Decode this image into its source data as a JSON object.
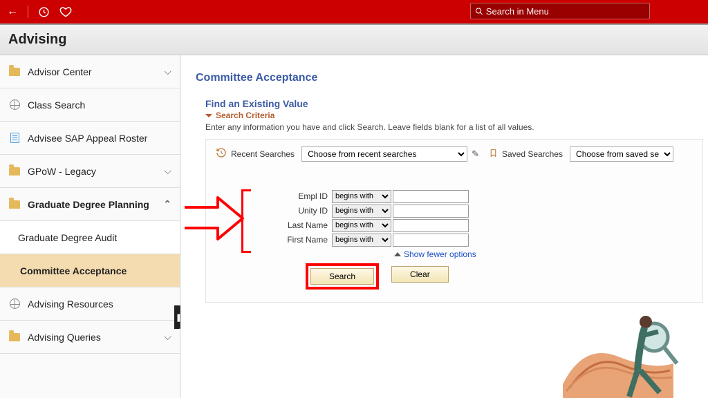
{
  "topbar": {
    "search_placeholder": "Search in Menu"
  },
  "title": "Advising",
  "sidebar": {
    "items": [
      {
        "label": "Advisor Center",
        "icon": "folder",
        "expand": "down"
      },
      {
        "label": "Class Search",
        "icon": "globe",
        "expand": ""
      },
      {
        "label": "Advisee SAP Appeal Roster",
        "icon": "doc",
        "expand": ""
      },
      {
        "label": "GPoW - Legacy",
        "icon": "folder",
        "expand": "down"
      },
      {
        "label": "Graduate Degree Planning",
        "icon": "folder",
        "expand": "up",
        "bold": true,
        "children": [
          {
            "label": "Graduate Degree Audit"
          },
          {
            "label": "Committee Acceptance",
            "active": true
          }
        ]
      },
      {
        "label": "Advising Resources",
        "icon": "globe",
        "expand": ""
      },
      {
        "label": "Advising Queries",
        "icon": "folder",
        "expand": "down"
      }
    ]
  },
  "main": {
    "page_title": "Committee Acceptance",
    "find_heading": "Find an Existing Value",
    "criteria_heading": "Search Criteria",
    "instruction": "Enter any information you have and click Search. Leave fields blank for a list of all values.",
    "recent_label": "Recent Searches",
    "recent_placeholder": "Choose from recent searches",
    "saved_label": "Saved Searches",
    "saved_placeholder": "Choose from saved searches",
    "fields": [
      {
        "label": "Empl ID",
        "op": "begins with"
      },
      {
        "label": "Unity ID",
        "op": "begins with"
      },
      {
        "label": "Last Name",
        "op": "begins with"
      },
      {
        "label": "First Name",
        "op": "begins with"
      }
    ],
    "show_fewer": "Show fewer options",
    "search_btn": "Search",
    "clear_btn": "Clear"
  }
}
